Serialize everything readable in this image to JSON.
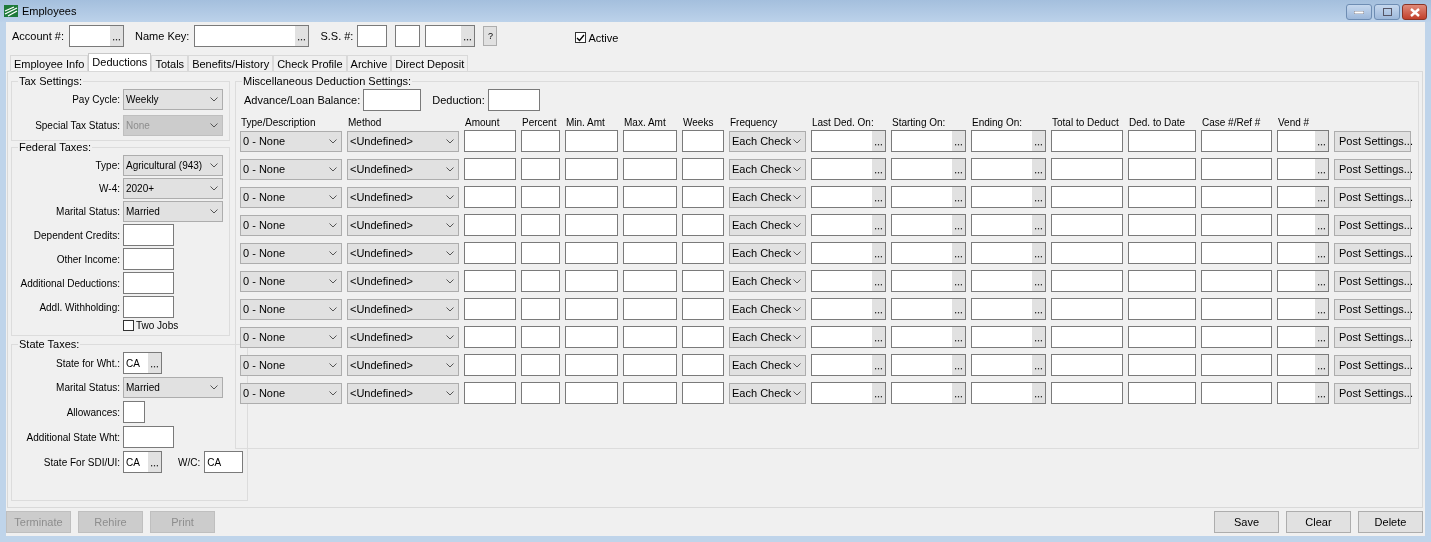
{
  "window": {
    "title": "Employees"
  },
  "header": {
    "account": {
      "label": "Account #:"
    },
    "name_key": {
      "label": "Name Key:"
    },
    "ss": {
      "label": "S.S. #:"
    },
    "help_button": "?",
    "active": {
      "label": "Active",
      "checked": true
    }
  },
  "tabs": [
    {
      "label": "Employee Info",
      "selected": false
    },
    {
      "label": "Deductions",
      "selected": true
    },
    {
      "label": "Totals",
      "selected": false
    },
    {
      "label": "Benefits/History",
      "selected": false
    },
    {
      "label": "Check Profile",
      "selected": false
    },
    {
      "label": "Archive",
      "selected": false
    },
    {
      "label": "Direct Deposit",
      "selected": false
    }
  ],
  "tax_settings": {
    "title": "Tax Settings:",
    "fields": [
      {
        "label": "Pay Cycle:",
        "value": "Weekly",
        "disabled": false
      },
      {
        "label": "Special Tax Status:",
        "value": "None",
        "disabled": true
      }
    ]
  },
  "federal_taxes": {
    "title": "Federal Taxes:",
    "fields": [
      {
        "kind": "select",
        "label": "Type:",
        "value": "Agricultural (943)"
      },
      {
        "kind": "select",
        "label": "W-4:",
        "value": "2020+"
      },
      {
        "kind": "select",
        "label": "Marital Status:",
        "value": "Married"
      },
      {
        "kind": "input",
        "label": "Dependent Credits:"
      },
      {
        "kind": "input",
        "label": "Other Income:"
      },
      {
        "kind": "input",
        "label": "Additional Deductions:"
      },
      {
        "kind": "input",
        "label": "Addl. Withholding:"
      }
    ],
    "two_jobs": {
      "label": "Two Jobs",
      "checked": false
    }
  },
  "state_taxes": {
    "title": "State Taxes:",
    "fields": [
      {
        "kind": "lookup",
        "label": "State for Wht.:",
        "value": "CA"
      },
      {
        "kind": "select",
        "label": "Marital Status:",
        "value": "Married"
      },
      {
        "kind": "tiny",
        "label": "Allowances:"
      },
      {
        "kind": "input",
        "label": "Additional State Wht:"
      },
      {
        "kind": "lookup_wc",
        "label": "State For SDI/UI:",
        "value": "CA",
        "wc_label": "W/C:",
        "wc_value": "CA"
      }
    ]
  },
  "misc": {
    "title": "Miscellaneous Deduction Settings:",
    "advance_label": "Advance/Loan Balance:",
    "deduction_label": "Deduction:",
    "columns": [
      {
        "label": "Type/Description",
        "kind": "select"
      },
      {
        "label": "Method",
        "kind": "select"
      },
      {
        "label": "Amount",
        "kind": "input"
      },
      {
        "label": "Percent",
        "kind": "input"
      },
      {
        "label": "Min. Amt",
        "kind": "input"
      },
      {
        "label": "Max. Amt",
        "kind": "input"
      },
      {
        "label": "Weeks",
        "kind": "input"
      },
      {
        "label": "Frequency",
        "kind": "select"
      },
      {
        "label": "Last Ded. On:",
        "kind": "lookup"
      },
      {
        "label": "Starting On:",
        "kind": "lookup"
      },
      {
        "label": "Ending On:",
        "kind": "lookup"
      },
      {
        "label": "Total to Deduct",
        "kind": "input"
      },
      {
        "label": "Ded. to Date",
        "kind": "input"
      },
      {
        "label": "Case #/Ref #",
        "kind": "input"
      },
      {
        "label": "Vend #",
        "kind": "lookup"
      },
      {
        "kind": "button"
      }
    ],
    "rows": [
      {
        "selects": [
          "0 - None",
          "<Undefined>",
          "Each Check"
        ],
        "post_button": "Post Settings..."
      },
      {
        "selects": [
          "0 - None",
          "<Undefined>",
          "Each Check"
        ],
        "post_button": "Post Settings..."
      },
      {
        "selects": [
          "0 - None",
          "<Undefined>",
          "Each Check"
        ],
        "post_button": "Post Settings..."
      },
      {
        "selects": [
          "0 - None",
          "<Undefined>",
          "Each Check"
        ],
        "post_button": "Post Settings..."
      },
      {
        "selects": [
          "0 - None",
          "<Undefined>",
          "Each Check"
        ],
        "post_button": "Post Settings..."
      },
      {
        "selects": [
          "0 - None",
          "<Undefined>",
          "Each Check"
        ],
        "post_button": "Post Settings..."
      },
      {
        "selects": [
          "0 - None",
          "<Undefined>",
          "Each Check"
        ],
        "post_button": "Post Settings..."
      },
      {
        "selects": [
          "0 - None",
          "<Undefined>",
          "Each Check"
        ],
        "post_button": "Post Settings..."
      },
      {
        "selects": [
          "0 - None",
          "<Undefined>",
          "Each Check"
        ],
        "post_button": "Post Settings..."
      },
      {
        "selects": [
          "0 - None",
          "<Undefined>",
          "Each Check"
        ],
        "post_button": "Post Settings..."
      }
    ]
  },
  "footer": {
    "left": [
      {
        "label": "Terminate",
        "disabled": true
      },
      {
        "label": "Rehire",
        "disabled": true
      },
      {
        "label": "Print",
        "disabled": true
      }
    ],
    "right": [
      {
        "label": "Save",
        "disabled": false
      },
      {
        "label": "Clear",
        "disabled": false
      },
      {
        "label": "Delete",
        "disabled": false
      }
    ]
  }
}
